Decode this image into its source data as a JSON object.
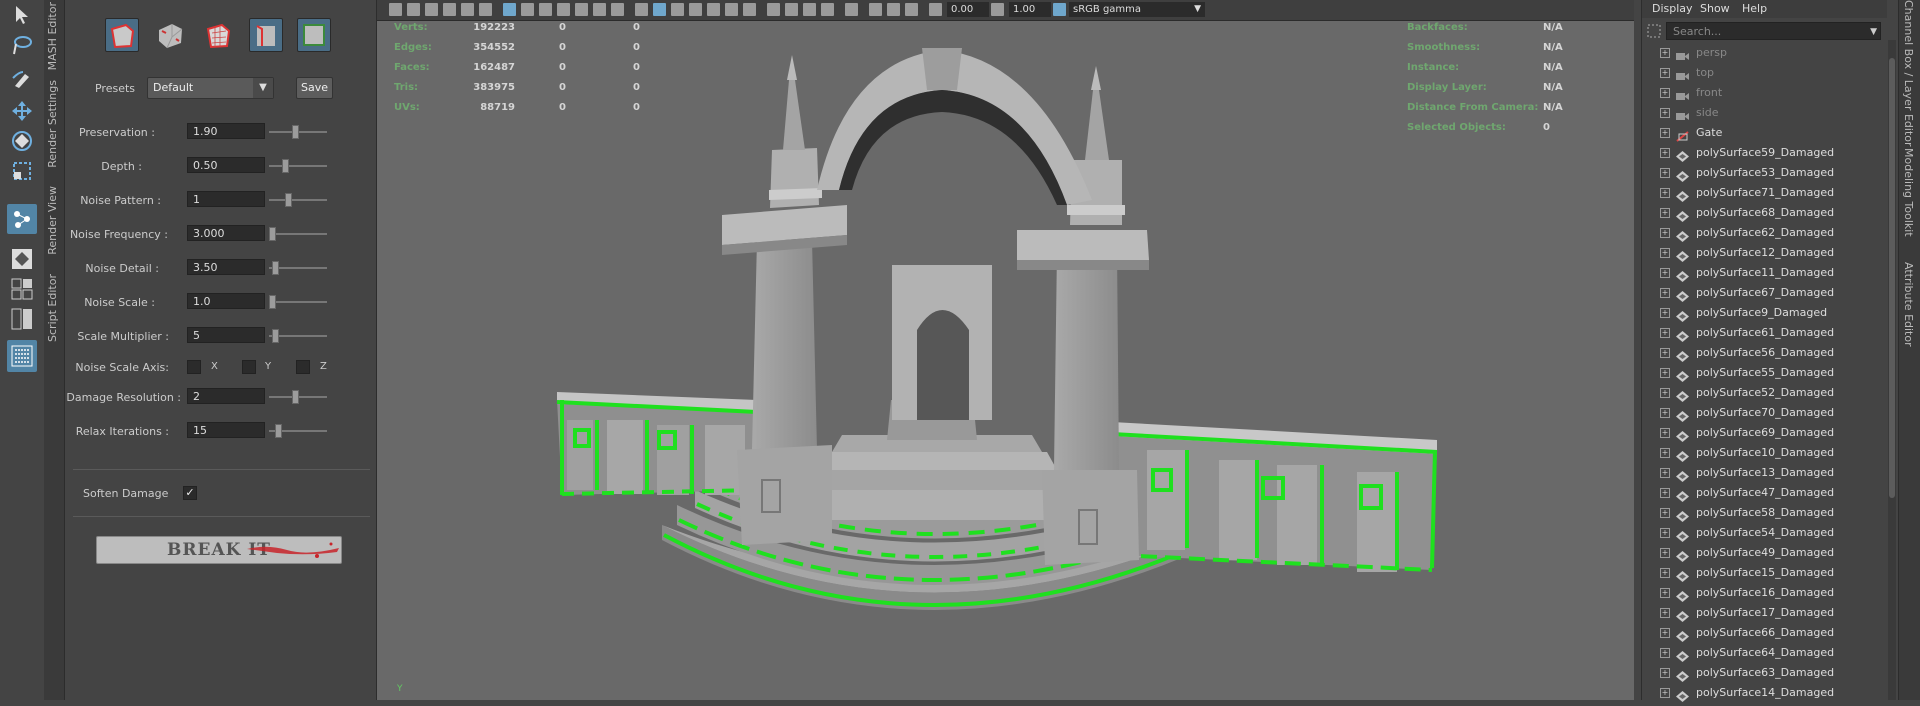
{
  "tool_strip": {
    "tools": [
      "select-tool-icon",
      "lasso-tool-icon",
      "paint-select-icon",
      "move-tool-icon",
      "rotate-tool-icon",
      "scale-tool-icon",
      "last-tool-icon",
      "layout-single-icon",
      "layout-four-icon",
      "layout-two-icon",
      "outliner-layout-icon"
    ]
  },
  "side_tabs_left": [
    "MASH Editor",
    "Render Settings",
    "Render View",
    "Script Editor"
  ],
  "panel": {
    "presets_label": "Presets",
    "preset_value": "Default",
    "save_label": "Save",
    "params": [
      {
        "label": "Preservation :",
        "value": "1.90",
        "slider": 0.44
      },
      {
        "label": "Depth :",
        "value": "0.50",
        "slider": 0.25
      },
      {
        "label": "Noise Pattern :",
        "value": "1",
        "slider": 0.3
      },
      {
        "label": "Noise Frequency :",
        "value": "3.000",
        "slider": 0.0
      },
      {
        "label": "Noise Detail :",
        "value": "3.50",
        "slider": 0.05
      },
      {
        "label": "Noise Scale :",
        "value": "1.0",
        "slider": 0.0
      },
      {
        "label": "Scale Multiplier :",
        "value": "5",
        "slider": 0.05
      }
    ],
    "noise_axis": {
      "label": "Noise Scale Axis:",
      "x": "X",
      "y": "Y",
      "z": "Z"
    },
    "params2": [
      {
        "label": "Damage Resolution :",
        "value": "2",
        "slider": 0.44
      },
      {
        "label": "Relax Iterations :",
        "value": "15",
        "slider": 0.12
      }
    ],
    "soften_label": "Soften Damage",
    "soften_checked": "✓",
    "break_label": "BREAK IT",
    "accent": "#5285a6"
  },
  "viewport": {
    "toolbar": {
      "value_a": "0.00",
      "value_b": "1.00",
      "colorspace": "sRGB gamma"
    },
    "hud_left": [
      {
        "label": "Verts:",
        "v1": "192223",
        "v2": "0",
        "v3": "0"
      },
      {
        "label": "Edges:",
        "v1": "354552",
        "v2": "0",
        "v3": "0"
      },
      {
        "label": "Faces:",
        "v1": "162487",
        "v2": "0",
        "v3": "0"
      },
      {
        "label": "Tris:",
        "v1": "383975",
        "v2": "0",
        "v3": "0"
      },
      {
        "label": "UVs:",
        "v1": "88719",
        "v2": "0",
        "v3": "0"
      }
    ],
    "hud_right": [
      {
        "label": "Backfaces:",
        "value": "N/A"
      },
      {
        "label": "Smoothness:",
        "value": "N/A"
      },
      {
        "label": "Instance:",
        "value": "N/A"
      },
      {
        "label": "Display Layer:",
        "value": "N/A"
      },
      {
        "label": "Distance From Camera:",
        "value": "N/A"
      },
      {
        "label": "Selected Objects:",
        "value": "0"
      }
    ],
    "damage_color": "#1fe01f"
  },
  "outliner": {
    "menu": [
      "Display",
      "Show",
      "Help"
    ],
    "search_placeholder": "Search...",
    "cameras": [
      "persp",
      "top",
      "front",
      "side"
    ],
    "items": [
      "Gate",
      "polySurface59_Damaged",
      "polySurface53_Damaged",
      "polySurface71_Damaged",
      "polySurface68_Damaged",
      "polySurface62_Damaged",
      "polySurface12_Damaged",
      "polySurface11_Damaged",
      "polySurface67_Damaged",
      "polySurface9_Damaged",
      "polySurface61_Damaged",
      "polySurface56_Damaged",
      "polySurface55_Damaged",
      "polySurface52_Damaged",
      "polySurface70_Damaged",
      "polySurface69_Damaged",
      "polySurface10_Damaged",
      "polySurface13_Damaged",
      "polySurface47_Damaged",
      "polySurface58_Damaged",
      "polySurface54_Damaged",
      "polySurface49_Damaged",
      "polySurface15_Damaged",
      "polySurface16_Damaged",
      "polySurface17_Damaged",
      "polySurface66_Damaged",
      "polySurface64_Damaged",
      "polySurface63_Damaged",
      "polySurface14_Damaged"
    ]
  },
  "side_tabs_right": [
    "Channel Box / Layer Editor",
    "Modeling Toolkit",
    "Attribute Editor"
  ]
}
